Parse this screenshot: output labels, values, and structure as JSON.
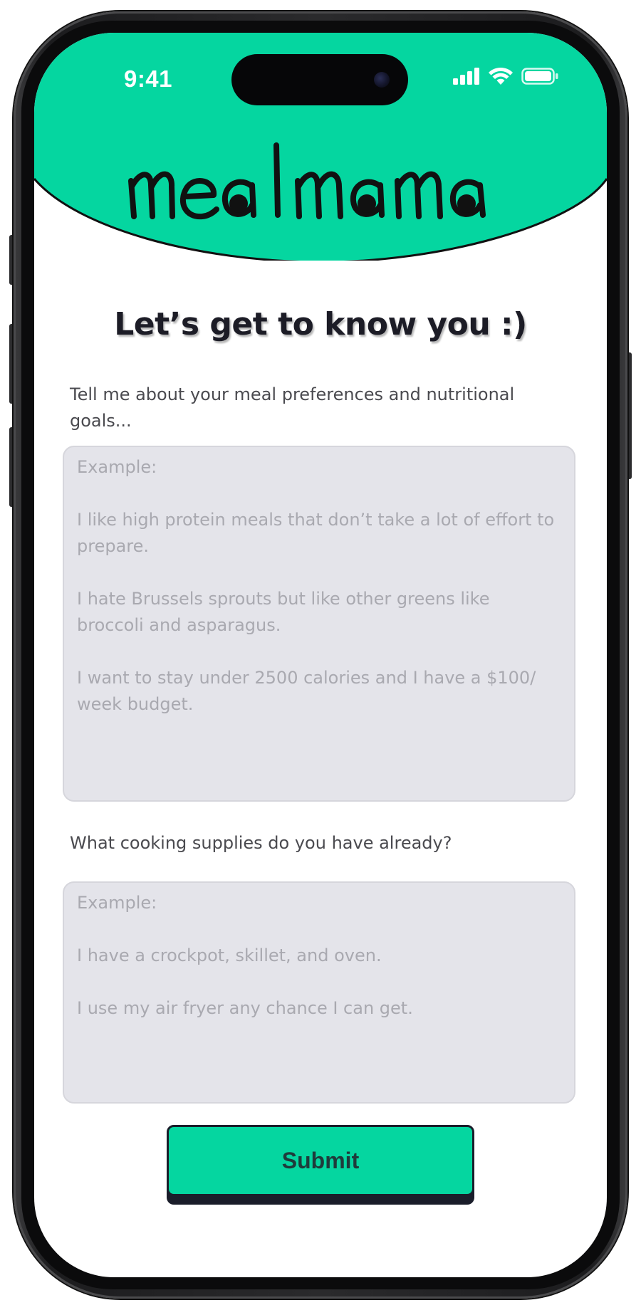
{
  "status_bar": {
    "time": "9:41",
    "icons": [
      "cellular-signal-icon",
      "wifi-icon",
      "battery-icon"
    ]
  },
  "header": {
    "logo_text": "mealmama",
    "background_color": "#05D6A0"
  },
  "page": {
    "title": "Let’s get to know you :)"
  },
  "form": {
    "preferences": {
      "label": "Tell me about your meal preferences and nutritional goals...",
      "placeholder": "Example:\n\nI like high protein meals that don’t take a lot of effort to prepare.\n\nI hate Brussels sprouts but like other greens like broccoli and asparagus.\n\nI want to stay under 2500 calories and I have a $100/ week budget."
    },
    "supplies": {
      "label": "What cooking supplies do you have already?",
      "placeholder": "Example:\n\nI have a crockpot, skillet, and oven.\n\nI use my air fryer any chance I can get."
    },
    "submit_label": "Submit"
  },
  "colors": {
    "accent": "#05D6A0",
    "input_background": "#E4E4EA",
    "button_border": "#1A1D2A"
  }
}
